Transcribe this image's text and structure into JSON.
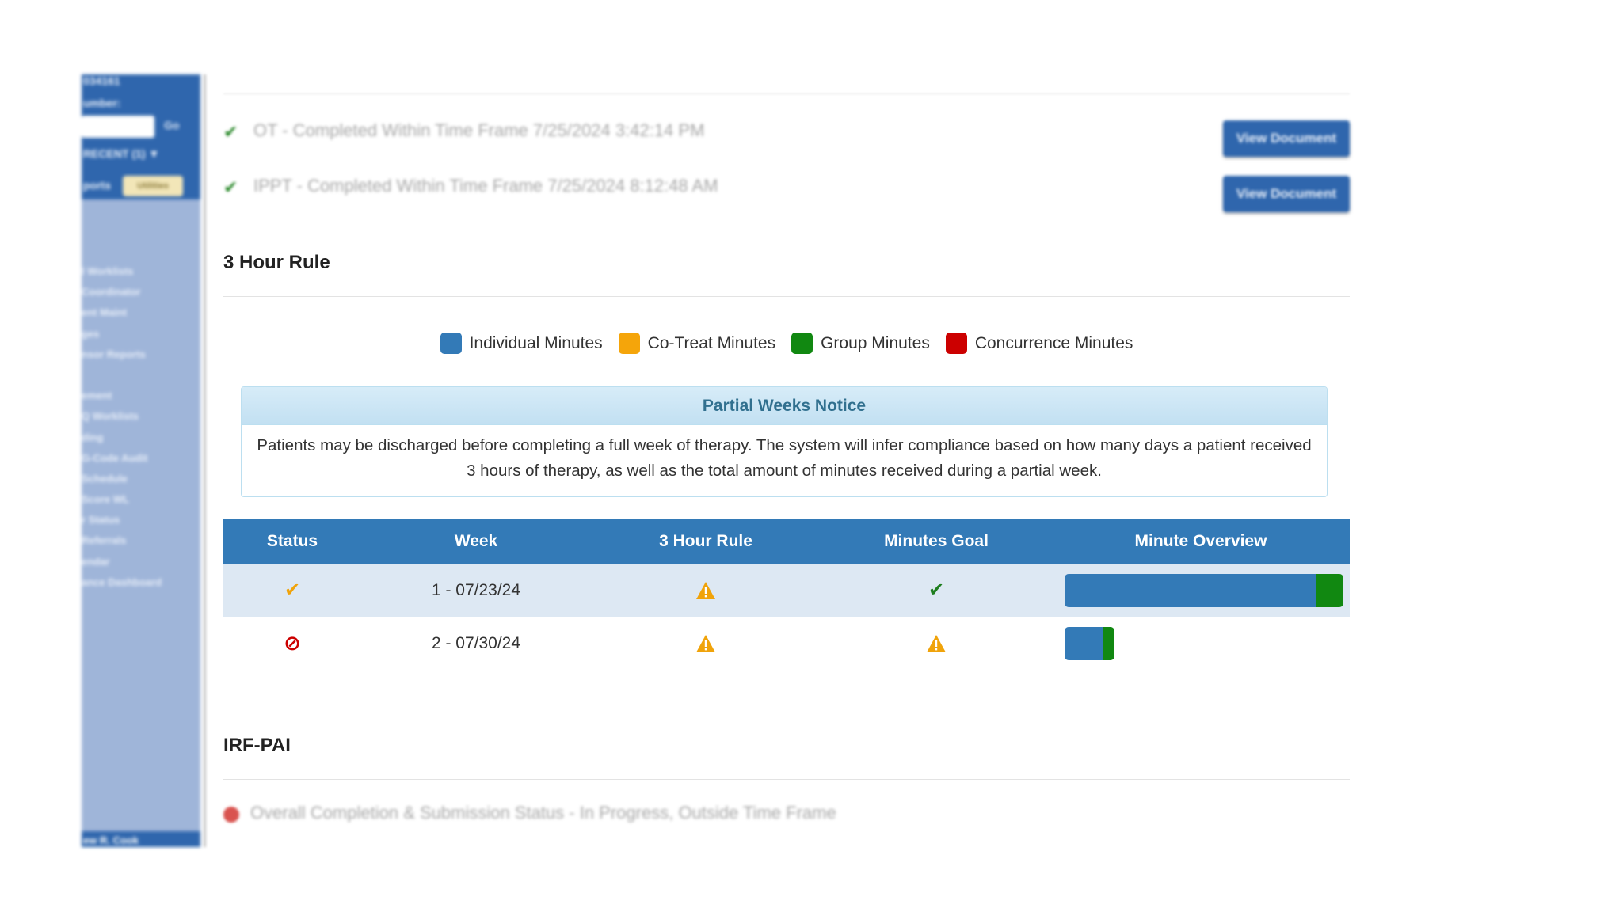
{
  "sidebar": {
    "id_fragment": "034161",
    "number_label": "umber:",
    "go_label": "Go",
    "recent_label": "RECENT (1) ▼",
    "reports_label": "ports",
    "utilities_label": "Utilities",
    "menu_items": [
      "l Worklists",
      "Coordinator",
      "ent Maint",
      "ges",
      "nsor Reports",
      "",
      "ement",
      "Q Worklists",
      "ding",
      "G-Code Audit",
      "Schedule",
      "Score WL",
      "r Status",
      "Referrals",
      "endar",
      "ance Dashboard"
    ],
    "user_label": "ew R. Cook"
  },
  "documents": [
    {
      "text": "OT - Completed Within Time Frame 7/25/2024 3:42:14 PM",
      "button": "View Document"
    },
    {
      "text": "IPPT - Completed Within Time Frame 7/25/2024 8:12:48 AM",
      "button": "View Document"
    }
  ],
  "three_hour_rule": {
    "title": "3 Hour Rule",
    "legend": [
      {
        "label": "Individual Minutes",
        "color": "#337ab7"
      },
      {
        "label": "Co-Treat Minutes",
        "color": "#f0a30a"
      },
      {
        "label": "Group Minutes",
        "color": "#118811"
      },
      {
        "label": "Concurrence Minutes",
        "color": "#cc0000"
      }
    ],
    "notice": {
      "title": "Partial Weeks Notice",
      "body_line1": "Patients may be discharged before completing a full week of therapy. The system will infer compliance based on how many days a patient received",
      "body_line2": "3 hours of therapy, as well as the total amount of minutes received during a partial week."
    },
    "table": {
      "headers": [
        "Status",
        "Week",
        "3 Hour Rule",
        "Minutes Goal",
        "Minute Overview"
      ],
      "rows": [
        {
          "status": "check-orange",
          "week": "1 - 07/23/24",
          "rule": "warning",
          "goal": "check-green",
          "overview": {
            "individual": 0.9,
            "cotreat": 0,
            "group": 0.1,
            "concurrence": 0,
            "total_fraction": 1.0
          }
        },
        {
          "status": "prohibited",
          "week": "2 - 07/30/24",
          "rule": "warning",
          "goal": "warning",
          "overview": {
            "individual": 0.75,
            "cotreat": 0,
            "group": 0.25,
            "concurrence": 0,
            "total_fraction": 0.18
          }
        }
      ]
    }
  },
  "irf_pai": {
    "title": "IRF-PAI",
    "status_text": "Overall Completion & Submission Status - In Progress, Outside Time Frame"
  },
  "colors": {
    "header_blue": "#337ab7",
    "notice_text": "#31708f"
  }
}
